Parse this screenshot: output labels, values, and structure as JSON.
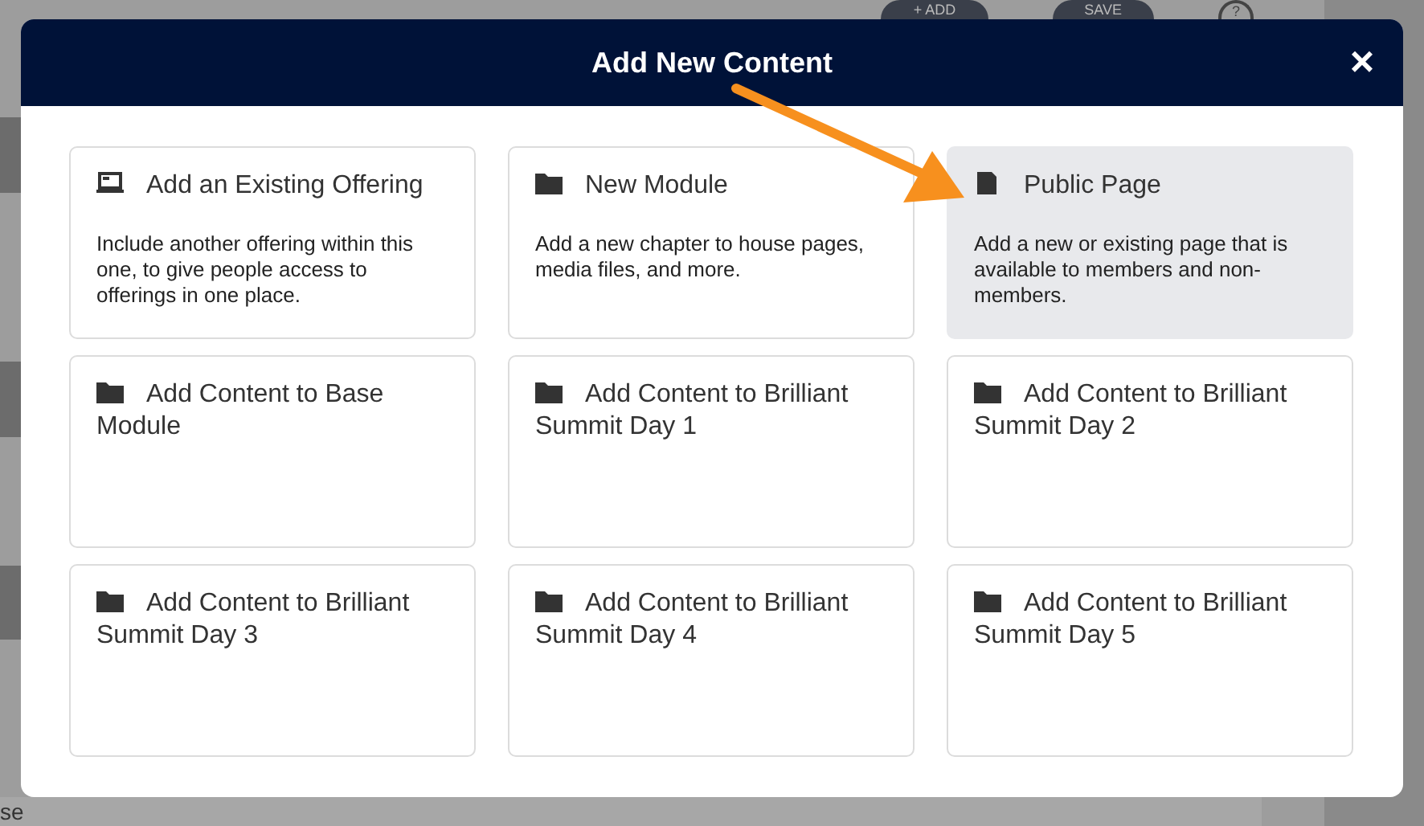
{
  "background": {
    "buttons": [
      "+ ADD",
      "SAVE"
    ],
    "help": "?",
    "field_text": "se"
  },
  "modal": {
    "title": "Add New Content",
    "close": "×",
    "options": [
      {
        "kind": "offering",
        "title": "Add an Existing Offering",
        "description": "Include another offering within this one, to give people access to offerings in one place.",
        "selected": false
      },
      {
        "kind": "folder",
        "title": "New Module",
        "description": "Add a new chapter to house pages, media files, and more.",
        "selected": false
      },
      {
        "kind": "page",
        "title": "Public Page",
        "description": "Add a new or existing page that is available to members and non-members.",
        "selected": true
      },
      {
        "kind": "folder",
        "title": "Add Content to Base Module",
        "selected": false
      },
      {
        "kind": "folder",
        "title": "Add Content to Brilliant Summit Day 1",
        "selected": false
      },
      {
        "kind": "folder",
        "title": "Add Content to Brilliant Summit Day 2",
        "selected": false
      },
      {
        "kind": "folder",
        "title": "Add Content to Brilliant Summit Day 3",
        "selected": false
      },
      {
        "kind": "folder",
        "title": "Add Content to Brilliant Summit Day 4",
        "selected": false
      },
      {
        "kind": "folder",
        "title": "Add Content to Brilliant Summit Day 5",
        "selected": false
      }
    ]
  }
}
